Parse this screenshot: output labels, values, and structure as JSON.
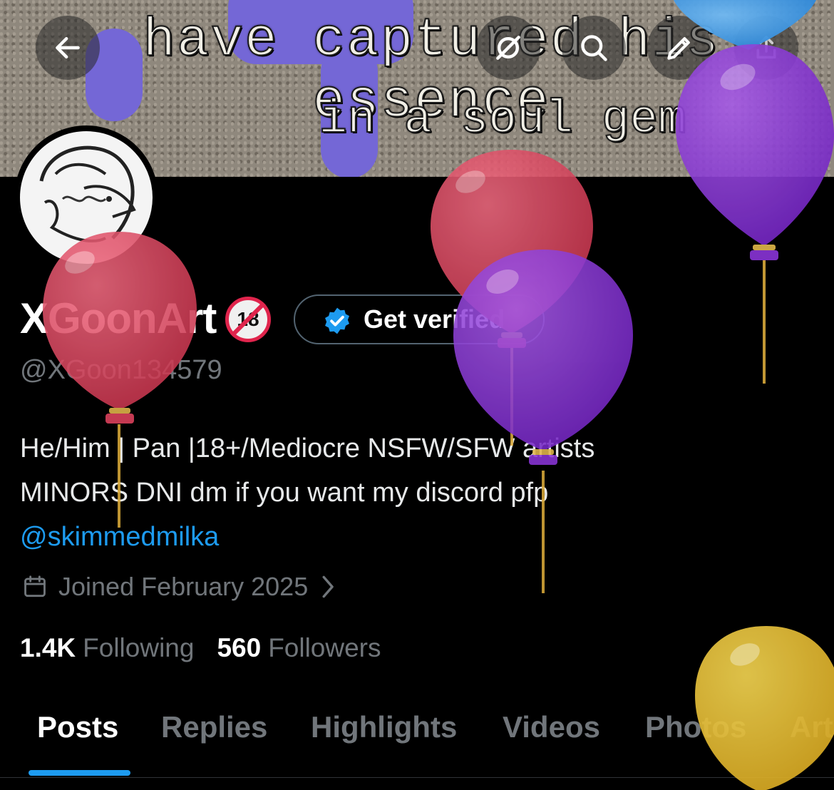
{
  "banner": {
    "line1": "have captured his essence",
    "line2": "in a soul gem"
  },
  "nav": {
    "back_icon": "arrow-left-icon",
    "grok_icon": "slashed-circle-icon",
    "search_icon": "search-icon",
    "edit_icon": "pencil-icon",
    "share_icon": "share-icon"
  },
  "profile": {
    "display_name": "XGoonArt",
    "age_badge": "18",
    "verify_button": "Get verified",
    "handle": "@XGoon134579",
    "bio_lines": [
      "He/Him | Pan |18+/Mediocre NSFW/SFW artists",
      "MINORS DNI dm if you want my discord pfp"
    ],
    "bio_mention": "@skimmedmilka",
    "joined": "Joined February 2025",
    "following_count": "1.4K",
    "following_label": "Following",
    "followers_count": "560",
    "followers_label": "Followers"
  },
  "tabs": [
    "Posts",
    "Replies",
    "Highlights",
    "Videos",
    "Photos",
    "Art"
  ],
  "active_tab": "Posts",
  "colors": {
    "background": "#000000",
    "accent": "#1d9bf0",
    "muted": "#71767b",
    "balloon_red": "#e0435e",
    "balloon_purple": "#8a35d8",
    "balloon_yellow": "#e8c13a",
    "balloon_blue": "#3d9be9"
  }
}
